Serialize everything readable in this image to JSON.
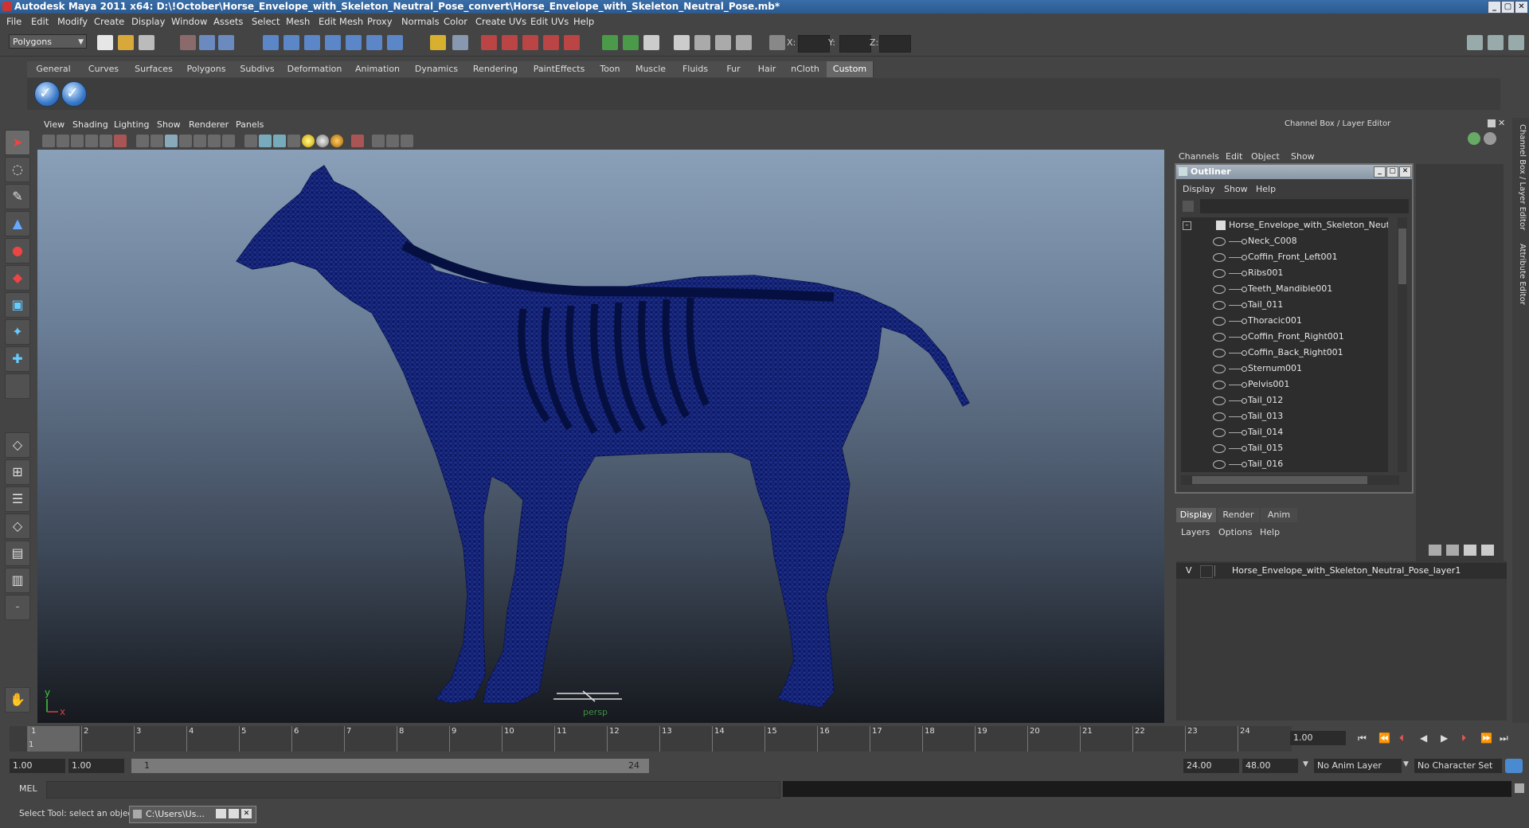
{
  "window": {
    "title": "Autodesk Maya 2011 x64: D:\\!October\\Horse_Envelope_with_Skeleton_Neutral_Pose_convert\\Horse_Envelope_with_Skeleton_Neutral_Pose.mb*",
    "minimize": "_",
    "maximize": "▢",
    "close": "✕"
  },
  "menubar": [
    "File",
    "Edit",
    "Modify",
    "Create",
    "Display",
    "Window",
    "Assets",
    "Select",
    "Mesh",
    "Edit Mesh",
    "Proxy",
    "Normals",
    "Color",
    "Create UVs",
    "Edit UVs",
    "Help"
  ],
  "statusline": {
    "mode": "Polygons",
    "x_label": "X:",
    "y_label": "Y:",
    "z_label": "Z:"
  },
  "shelf": {
    "tabs": [
      "General",
      "Curves",
      "Surfaces",
      "Polygons",
      "Subdivs",
      "Deformation",
      "Animation",
      "Dynamics",
      "Rendering",
      "PaintEffects",
      "Toon",
      "Muscle",
      "Fluids",
      "Fur",
      "Hair",
      "nCloth",
      "Custom"
    ],
    "active_tab": "Custom",
    "check_glyph": "✓"
  },
  "viewport": {
    "menu": [
      "View",
      "Shading",
      "Lighting",
      "Show",
      "Renderer",
      "Panels"
    ],
    "camera_label": "persp",
    "axis_y": "y",
    "axis_x": "x",
    "mesh_color": "#0c1a66"
  },
  "right_panel": {
    "title": "Channel Box / Layer Editor",
    "channel_menu": [
      "Channels",
      "Edit",
      "Object",
      "Show"
    ],
    "side_tabs": [
      "Channel Box / Layer Editor",
      "Attribute Editor"
    ]
  },
  "outliner": {
    "title": "Outliner",
    "menu": [
      "Display",
      "Show",
      "Help"
    ],
    "root": "Horse_Envelope_with_Skeleton_Neutral_P",
    "items": [
      "Neck_C008",
      "Coffin_Front_Left001",
      "Ribs001",
      "Teeth_Mandible001",
      "Tail_011",
      "Thoracic001",
      "Coffin_Front_Right001",
      "Coffin_Back_Right001",
      "Sternum001",
      "Pelvis001",
      "Tail_012",
      "Tail_013",
      "Tail_014",
      "Tail_015",
      "Tail_016"
    ]
  },
  "layer_editor": {
    "tabs": [
      "Display",
      "Render",
      "Anim"
    ],
    "menu": [
      "Layers",
      "Options",
      "Help"
    ],
    "layer_visible": "V",
    "layer_name": "Horse_Envelope_with_Skeleton_Neutral_Pose_layer1"
  },
  "timeline": {
    "ticks": [
      "1",
      "2",
      "3",
      "4",
      "5",
      "6",
      "7",
      "8",
      "9",
      "10",
      "11",
      "12",
      "13",
      "14",
      "15",
      "16",
      "17",
      "18",
      "19",
      "20",
      "21",
      "22",
      "23",
      "24"
    ],
    "current_frame_marker": "1",
    "current_frame": "1.00"
  },
  "range": {
    "start": "1.00",
    "playback_start": "1.00",
    "slider_start": "1",
    "slider_end": "24",
    "playback_end": "24.00",
    "end": "48.00",
    "anim_layer": "No Anim Layer",
    "character_set": "No Character Set"
  },
  "command_line": {
    "label": "MEL"
  },
  "help_line": {
    "text": "Select Tool: select an object",
    "task": "C:\\Users\\Us..."
  }
}
